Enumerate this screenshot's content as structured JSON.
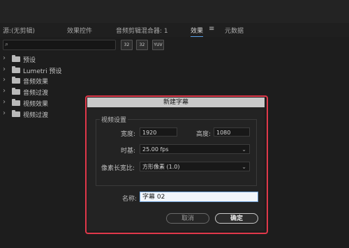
{
  "tabs": [
    {
      "label": "源:(无剪辑)"
    },
    {
      "label": "效果控件"
    },
    {
      "label": "音频剪辑混合器: 1"
    },
    {
      "label": "效果",
      "menu_glyph": "≡"
    },
    {
      "label": "元数据"
    }
  ],
  "toolbar": {
    "search_icon": "magnifier-icon",
    "buttons": [
      "32",
      "32",
      "YUV"
    ]
  },
  "tree": [
    {
      "label": "预设"
    },
    {
      "label": "Lumetri 预设"
    },
    {
      "label": "音频效果"
    },
    {
      "label": "音频过渡"
    },
    {
      "label": "视频效果"
    },
    {
      "label": "视频过渡"
    }
  ],
  "dialog": {
    "title": "新建字幕",
    "group_title": "视频设置",
    "width_label": "宽度:",
    "width_value": "1920",
    "height_label": "高度:",
    "height_value": "1080",
    "timebase_label": "时基:",
    "timebase_value": "25.00 fps",
    "par_label": "像素长宽比:",
    "par_value": "方形像素 (1.0)",
    "name_label": "名称:",
    "name_value": "字幕 02",
    "cancel_label": "取消",
    "ok_label": "确定"
  },
  "colors": {
    "highlight_outline": "#e0384a",
    "active_tab_line": "#5aa0e6"
  }
}
